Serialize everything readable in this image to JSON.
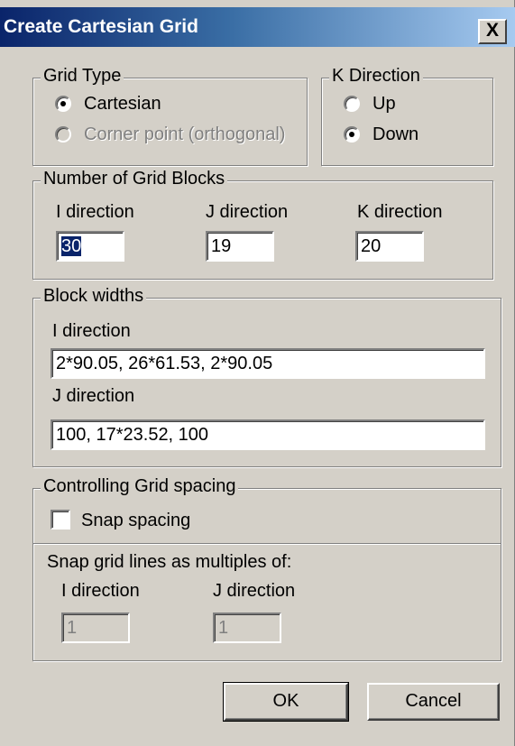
{
  "window": {
    "title": "Create Cartesian Grid",
    "close_glyph": "X"
  },
  "grid_type": {
    "label": "Grid Type",
    "options": [
      {
        "label": "Cartesian",
        "selected": true,
        "enabled": true
      },
      {
        "label": "Corner point (orthogonal)",
        "selected": false,
        "enabled": false
      }
    ]
  },
  "k_direction": {
    "label": "K Direction",
    "options": [
      {
        "label": "Up",
        "selected": false
      },
      {
        "label": "Down",
        "selected": true
      }
    ]
  },
  "num_blocks": {
    "label": "Number of Grid Blocks",
    "i_label": "I direction",
    "j_label": "J direction",
    "k_label": "K direction",
    "i_value": "30",
    "j_value": "19",
    "k_value": "20"
  },
  "block_widths": {
    "label": "Block widths",
    "i_label": "I direction",
    "i_value": "2*90.05, 26*61.53, 2*90.05",
    "j_label": "J direction",
    "j_value": "100, 17*23.52, 100"
  },
  "spacing": {
    "label": "Controlling Grid spacing",
    "snap_label": "Snap spacing",
    "snap_checked": false,
    "multiples_label": "Snap grid lines as multiples of:",
    "i_label": "I direction",
    "j_label": "J direction",
    "i_value": "1",
    "j_value": "1"
  },
  "buttons": {
    "ok": "OK",
    "cancel": "Cancel"
  }
}
